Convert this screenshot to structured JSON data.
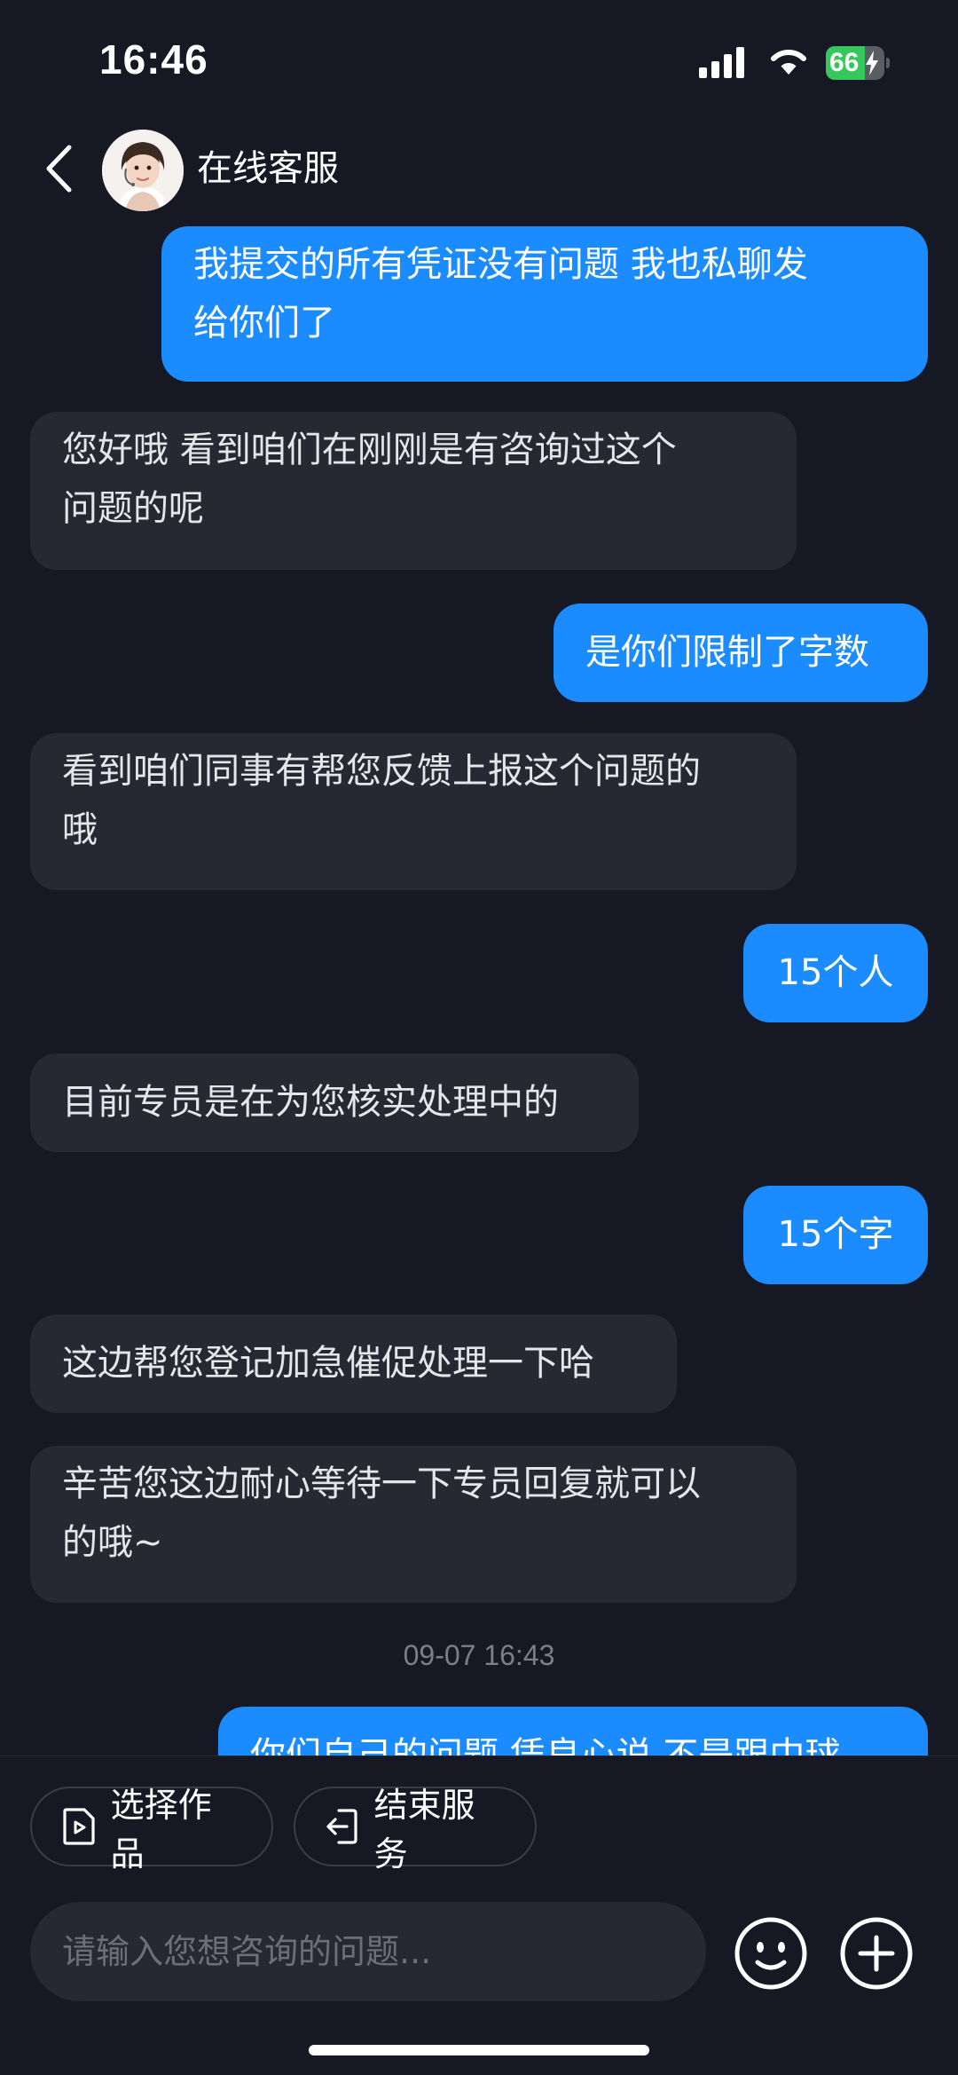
{
  "status_bar": {
    "time": "16:46",
    "battery_level": "66",
    "battery_fraction": 0.66,
    "battery_color": "#34c759"
  },
  "header": {
    "title": "在线客服",
    "avatar_alt": "客服头像"
  },
  "messages": [
    {
      "side": "out",
      "lines": [
        "我提交的所有凭证没有问题 我也私聊发",
        "给你们了"
      ]
    },
    {
      "side": "in",
      "lines": [
        "您好哦 看到咱们在刚刚是有咨询过这个",
        "问题的呢"
      ]
    },
    {
      "side": "out",
      "lines": [
        "是你们限制了字数"
      ]
    },
    {
      "side": "in",
      "lines": [
        "看到咱们同事有帮您反馈上报这个问题的",
        "哦"
      ]
    },
    {
      "side": "out",
      "lines": [
        "15个人"
      ]
    },
    {
      "side": "in",
      "lines": [
        "目前专员是在为您核实处理中的"
      ]
    },
    {
      "side": "out",
      "lines": [
        "15个字"
      ]
    },
    {
      "side": "in",
      "lines": [
        "这边帮您登记加急催促处理一下哈"
      ]
    },
    {
      "side": "in",
      "lines": [
        "辛苦您这边耐心等待一下专员回复就可以",
        "的哦~"
      ]
    },
    {
      "side": "time",
      "text": "09-07 16:43"
    },
    {
      "side": "out",
      "lines": [
        "你们自己的问题 凭良心说 不是跟中球"
      ]
    }
  ],
  "actions": {
    "select_work": "选择作品",
    "end_service": "结束服务"
  },
  "input": {
    "placeholder": "请输入您想咨询的问题..."
  },
  "colors": {
    "background": "#161823",
    "outgoing_bubble": "#1a8cff",
    "incoming_bubble": "#262832"
  }
}
